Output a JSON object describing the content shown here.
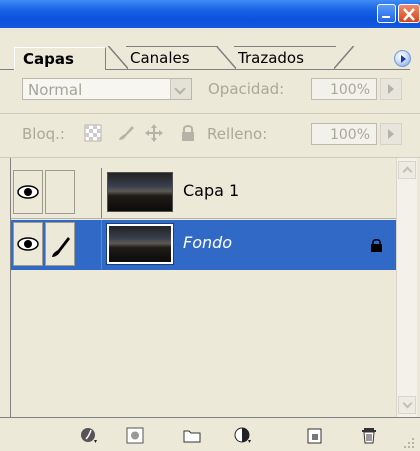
{
  "tabs": [
    {
      "label": "Capas",
      "active": true
    },
    {
      "label": "Canales",
      "active": false
    },
    {
      "label": "Trazados",
      "active": false
    }
  ],
  "blend": {
    "mode": "Normal",
    "opacity_label": "Opacidad:",
    "opacity_value": "100%"
  },
  "lock": {
    "label": "Bloq.:",
    "fill_label": "Relleno:",
    "fill_value": "100%"
  },
  "layers": [
    {
      "name": "Capa 1",
      "visible": true,
      "selected": false
    },
    {
      "name": "Fondo",
      "visible": true,
      "selected": true,
      "locked": true
    }
  ],
  "bottom_icons": [
    "layer-style-icon",
    "layer-mask-icon",
    "new-group-icon",
    "adjustment-layer-icon",
    "new-layer-icon",
    "trash-icon"
  ],
  "colors": {
    "selection": "#3169c6",
    "panel": "#ece9d8",
    "titlebar": "#0a52de"
  }
}
